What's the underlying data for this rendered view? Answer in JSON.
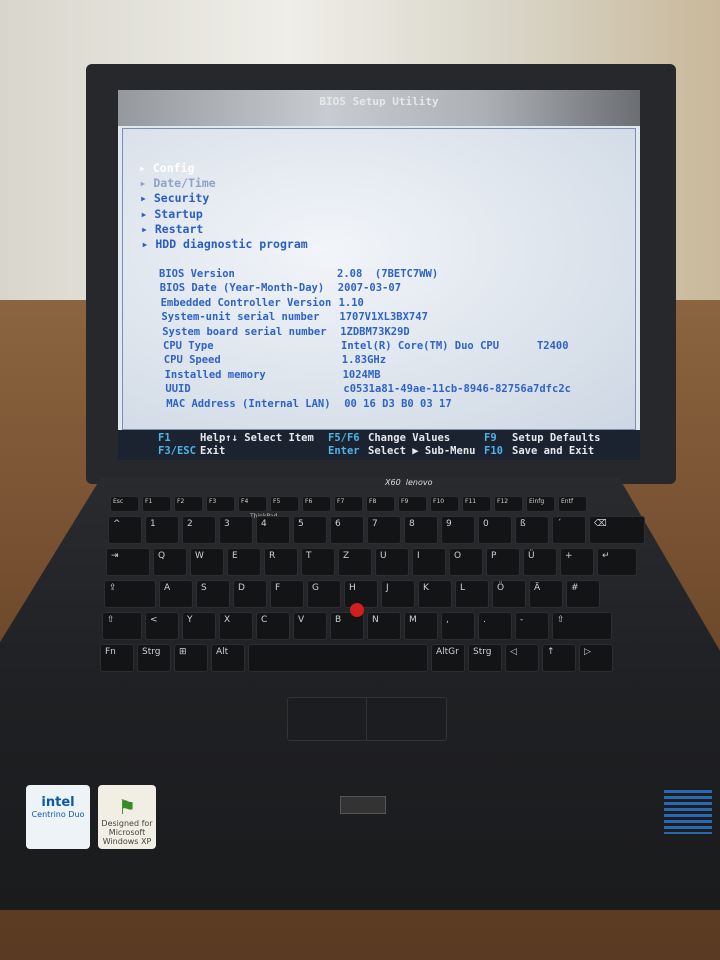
{
  "bios": {
    "title": "BIOS Setup Utility",
    "menu": [
      {
        "label": "Config",
        "state": "selected"
      },
      {
        "label": "Date/Time",
        "state": "disabled"
      },
      {
        "label": "Security",
        "state": "normal"
      },
      {
        "label": "Startup",
        "state": "normal"
      },
      {
        "label": "Restart",
        "state": "normal"
      },
      {
        "label": "HDD diagnostic program",
        "state": "normal"
      }
    ],
    "info": [
      {
        "k": "BIOS Version",
        "v": "2.08  (7BETC7WW)"
      },
      {
        "k": "BIOS Date (Year-Month-Day)",
        "v": "2007-03-07"
      },
      {
        "k": "Embedded Controller Version",
        "v": "1.10"
      },
      {
        "k": "System-unit serial number",
        "v": "1707V1XL3BX747"
      },
      {
        "k": "System board serial number",
        "v": "1ZDBM73K29D"
      },
      {
        "k": "CPU Type",
        "v": "Intel(R) Core(TM) Duo CPU      T2400"
      },
      {
        "k": "CPU Speed",
        "v": "1.83GHz"
      },
      {
        "k": "Installed memory",
        "v": "1024MB"
      },
      {
        "k": "UUID",
        "v": "c0531a81-49ae-11cb-8946-82756a7dfc2c"
      },
      {
        "k": "MAC Address (Internal LAN)",
        "v": "00 16 D3 B0 03 17"
      }
    ],
    "footer": [
      [
        {
          "key": "F1",
          "label": "Help↑↓ Select Item"
        },
        {
          "key": "F5/F6",
          "label": "Change Values"
        },
        {
          "key": "F9",
          "label": "Setup Defaults"
        }
      ],
      [
        {
          "key": "F3/ESC",
          "label": "Exit"
        },
        {
          "key": "Enter",
          "label": "Select ▶ Sub-Menu"
        },
        {
          "key": "F10",
          "label": "Save and Exit"
        }
      ]
    ]
  },
  "laptop": {
    "model": "X60",
    "brand": "lenovo",
    "keyboard_logo": "ThinkPad",
    "trackpoint_color": "#d11f1f",
    "stickers": {
      "intel": [
        "intel",
        "Centrino Duo"
      ],
      "windows": [
        "Designed for",
        "Microsoft Windows XP"
      ]
    }
  },
  "keyboard": [
    [
      "Esc",
      "F1",
      "F2",
      "F3",
      "F4",
      "F5",
      "F6",
      "F7",
      "F8",
      "F9",
      "F10",
      "F11",
      "F12",
      "Einfg",
      "Entf"
    ],
    [
      "^",
      "1",
      "2",
      "3",
      "4",
      "5",
      "6",
      "7",
      "8",
      "9",
      "0",
      "ß",
      "´",
      "⌫"
    ],
    [
      "⇥",
      "Q",
      "W",
      "E",
      "R",
      "T",
      "Z",
      "U",
      "I",
      "O",
      "P",
      "Ü",
      "+",
      "↵"
    ],
    [
      "⇪",
      "A",
      "S",
      "D",
      "F",
      "G",
      "H",
      "J",
      "K",
      "L",
      "Ö",
      "Ä",
      "#"
    ],
    [
      "⇧",
      "<",
      "Y",
      "X",
      "C",
      "V",
      "B",
      "N",
      "M",
      ",",
      ".",
      "-",
      "⇧"
    ],
    [
      "Fn",
      "Strg",
      "⊞",
      "Alt",
      "",
      "AltGr",
      "Strg",
      "◁",
      "↑",
      "▷"
    ]
  ]
}
